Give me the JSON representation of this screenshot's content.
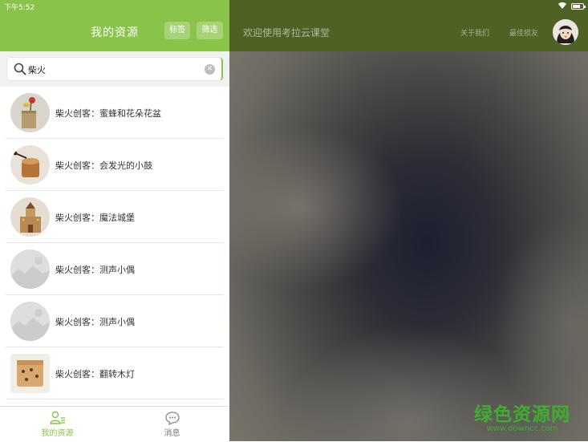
{
  "status": {
    "time": "下午5:52"
  },
  "left": {
    "title": "我的资源",
    "tag_button": "标签",
    "filter_button": "筛选",
    "search": {
      "value": "柴火"
    },
    "items": [
      {
        "name": "柴火创客：蜜蜂和花朵花盆",
        "thumb": "planter-photo"
      },
      {
        "name": "柴火创客：会发光的小鼓",
        "thumb": "drum-photo"
      },
      {
        "name": "柴火创客：魔法城堡",
        "thumb": "castle-photo"
      },
      {
        "name": "柴火创客：测声小偶",
        "thumb": "placeholder-image"
      },
      {
        "name": "柴火创客：测声小偶",
        "thumb": "placeholder-image"
      },
      {
        "name": "柴火创客：翻转木灯",
        "thumb": "wood-lamp-photo"
      }
    ],
    "tabs": [
      {
        "label": "我的资源",
        "icon": "user-list-icon"
      },
      {
        "label": "消息",
        "icon": "chat-bubble-icon"
      }
    ]
  },
  "right": {
    "welcome": "欢迎使用考拉云课堂",
    "about": "关于我们",
    "friends": "最佳损友"
  },
  "watermark": {
    "cn": "绿色资源网",
    "url": "www.downcc.com"
  },
  "colors": {
    "accent": "#8ac349",
    "right_header": "#4e6225",
    "watermark": "#3fae2f"
  }
}
